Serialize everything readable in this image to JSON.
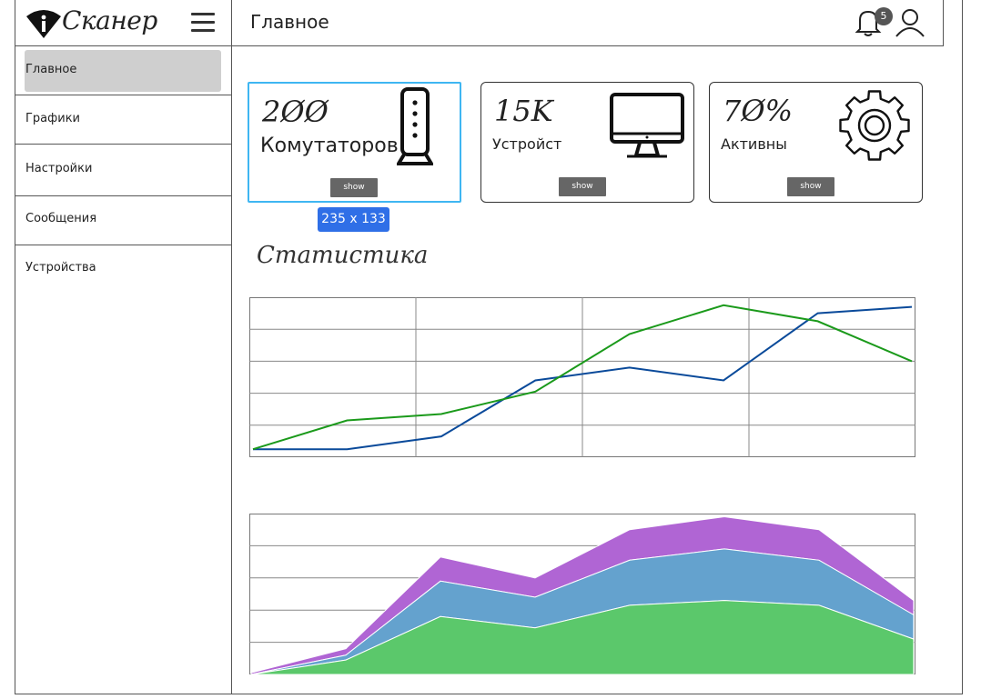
{
  "app": {
    "name": "Сканер"
  },
  "sidebar": {
    "items": [
      {
        "label": "Главное",
        "active": true
      },
      {
        "label": "Графики"
      },
      {
        "label": "Настройки"
      },
      {
        "label": "Сообщения"
      },
      {
        "label": "Устройства"
      }
    ]
  },
  "header": {
    "title": "Главное",
    "notifications": "5"
  },
  "cards": [
    {
      "value": "2ØØ",
      "label": "Комутаторов",
      "button": "show",
      "icon": "router-icon"
    },
    {
      "value": "15K",
      "label": "Устройст",
      "button": "show",
      "icon": "monitor-icon"
    },
    {
      "value": "7Ø%",
      "label": "Активны",
      "button": "show",
      "icon": "gear-icon"
    }
  ],
  "selection_tooltip": "235 x 133",
  "section": {
    "title": "Статистика"
  },
  "chart_data": [
    {
      "type": "line",
      "grid": true,
      "ylim": [
        0,
        5
      ],
      "x": [
        0,
        1,
        2,
        3,
        4,
        5,
        6,
        7
      ],
      "series": [
        {
          "color": "#0a4a9a",
          "values": [
            0.25,
            0.25,
            0.65,
            2.4,
            2.8,
            2.4,
            4.5,
            4.7
          ]
        },
        {
          "color": "#1b9a1b",
          "values": [
            0.25,
            1.15,
            1.35,
            2.05,
            3.85,
            4.75,
            4.25,
            3.0
          ]
        }
      ]
    },
    {
      "type": "area",
      "stacked": true,
      "grid": true,
      "ylim": [
        0,
        5
      ],
      "x": [
        0,
        1,
        2,
        3,
        4,
        5,
        6,
        7
      ],
      "series": [
        {
          "color": "#5bc86b",
          "values": [
            0,
            0.45,
            1.8,
            1.45,
            2.15,
            2.3,
            2.15,
            1.1
          ]
        },
        {
          "color": "#64a2ce",
          "values": [
            0,
            0.15,
            1.1,
            0.95,
            1.4,
            1.6,
            1.4,
            0.75
          ]
        },
        {
          "color": "#b065d4",
          "values": [
            0.05,
            0.2,
            0.75,
            0.6,
            0.95,
            1.0,
            0.95,
            0.45
          ]
        }
      ]
    }
  ]
}
